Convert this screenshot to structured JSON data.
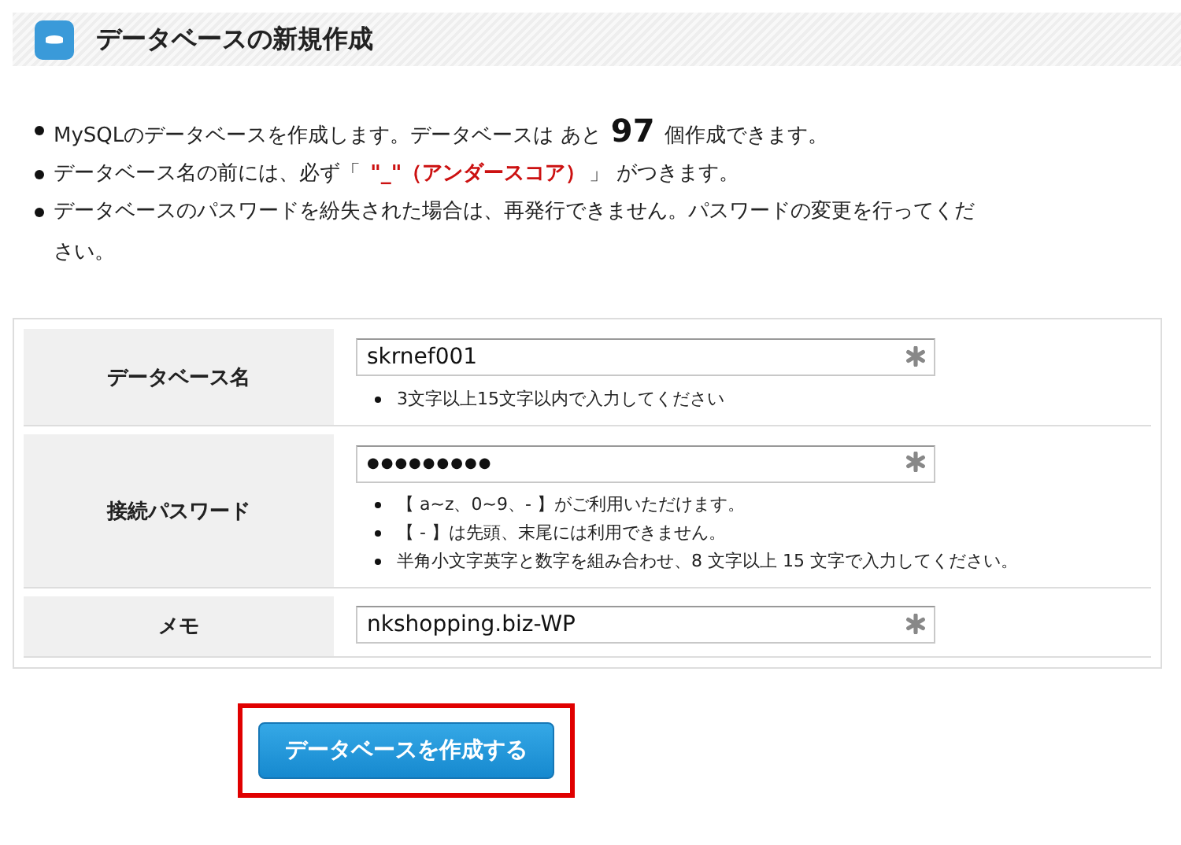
{
  "header": {
    "title": "データベースの新規作成"
  },
  "notes": [
    {
      "parts": [
        {
          "text": "MySQLのデータベースを作成します。データベースは あと ",
          "kind": "normal"
        },
        {
          "text": "97",
          "kind": "count"
        },
        {
          "text": " 個作成できます。",
          "kind": "normal"
        }
      ]
    },
    {
      "parts": [
        {
          "text": "データベース名の前には、必ず「 ",
          "kind": "normal"
        },
        {
          "text": "\"_\"（アンダースコア）",
          "kind": "warning"
        },
        {
          "text": "」 がつきます。",
          "kind": "normal"
        }
      ]
    },
    {
      "parts": [
        {
          "text": "データベースのパスワードを紛失された場合は、再発行できません。パスワードの変更を行ってください。",
          "kind": "normal"
        }
      ]
    }
  ],
  "form": {
    "rows": [
      {
        "label": "データベース名",
        "value": "skrnef001",
        "required": true,
        "hints": [
          "3文字以上15文字以内で入力してください"
        ]
      },
      {
        "label": "接続パスワード",
        "value": "●●●●●●●●●",
        "masked": true,
        "required": true,
        "hints": [
          "【 a~z、0~9、- 】がご利用いただけます。",
          "【 - 】は先頭、末尾には利用できません。",
          "半角小文字英字と数字を組み合わせ、8 文字以上 15 文字で入力してください。"
        ]
      },
      {
        "label": "メモ",
        "value": "nkshopping.biz-WP",
        "required": true,
        "hints": []
      }
    ]
  },
  "submit": {
    "label": "データベースを作成する",
    "highlighted": true
  }
}
